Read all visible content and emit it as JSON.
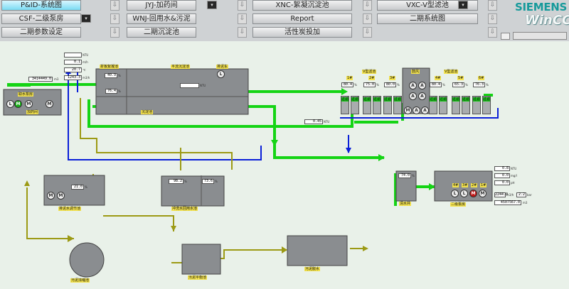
{
  "nav": {
    "row1": [
      "P&ID-系统图",
      "JYJ-加药间",
      "XNC-絮凝沉淀池",
      "VXC-V型滤池"
    ],
    "row2": [
      "CSF-二级泵房",
      "WNJ-回用水&污泥",
      "Report",
      "二期系统图"
    ],
    "row3": [
      "二期参数设定",
      "二期沉淀池",
      "活性炭投加"
    ]
  },
  "logo": {
    "brand": "SIEMENS",
    "product": "WinCC"
  },
  "colors": {
    "water": "#14d414",
    "return": "#0a1fd8",
    "sludge": "#9c9a14",
    "equipment": "#8a8d90",
    "label": "#f3e24d"
  },
  "process": {
    "inlet": {
      "turbidity": "NTU",
      "ph": "0.1",
      "ph_unit": "m/h",
      "temp": "20.7",
      "temp_unit": "℃",
      "flow": "1243.3",
      "flow_unit": "m3/h",
      "total": "3414449.0",
      "total_unit": "m3",
      "station_label": "取水泵房",
      "station_caption": "加药间"
    },
    "sedimentation": {
      "mixer_label": "折板絮凝池",
      "level1": "40.9",
      "level2": "76.4",
      "settler_label": "平流沉淀池",
      "drain_label": "排泥车",
      "turbidity_unit": "NTU",
      "caption": "沉淀池"
    },
    "filters": {
      "title": "V型滤池",
      "inlet_label": "滤后",
      "groups": [
        {
          "name": "1#",
          "level": "80.4"
        },
        {
          "name": "2#",
          "level": "75.0"
        },
        {
          "name": "3#",
          "level": "80.0"
        },
        {
          "name": "4#",
          "level": "80.4"
        },
        {
          "name": "5#",
          "level": "65.3"
        },
        {
          "name": "6#",
          "level": "76.3"
        }
      ],
      "status": "过滤",
      "blower_label": "鼓风",
      "outflow": "0.45",
      "outflow_unit": "NTU"
    },
    "reservoir": {
      "label": "清水井",
      "level": "74.0",
      "unit": "%"
    },
    "pump2": {
      "label": "二级泵房",
      "turb": "0.8",
      "turb_unit": "NTU",
      "chlorine": "0.0",
      "chlorine_unit": "mg/l",
      "ph": "0.0",
      "ph_unit": "pH",
      "flow": "2244.0",
      "flow_unit": "m3/h",
      "pressure": "2.2",
      "pressure_unit": "bar",
      "total": "4507567.0",
      "total_unit": "m3",
      "pumps": [
        "L",
        "L",
        "M",
        "M"
      ],
      "pump_labels": [
        "4#",
        "3#",
        "2#",
        "1#"
      ]
    },
    "sludge_tank": {
      "label": "排泥水调节池",
      "level": "21.0"
    },
    "reuse_tank": {
      "label": "冲洗水回用水池",
      "level1": "98.2",
      "level2": "73.6"
    },
    "sludge_pump": {
      "label": "污泥浓缩池"
    },
    "sludge_balance": {
      "label": "污泥平衡池"
    },
    "dewater": {
      "label": "污泥脱水"
    }
  }
}
